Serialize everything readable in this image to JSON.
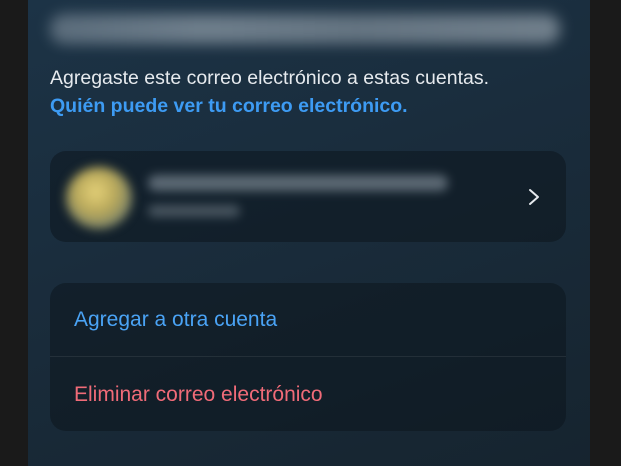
{
  "description": {
    "text": "Agregaste este correo electrónico a estas cuentas.",
    "link": "Quién puede ver tu correo electrónico."
  },
  "account": {
    "icon": "chevron-right-icon"
  },
  "actions": {
    "add_label": "Agregar a otra cuenta",
    "remove_label": "Eliminar correo electrónico"
  },
  "colors": {
    "link": "#3d9bf3",
    "action_add": "#4aa3f5",
    "action_remove": "#f06b78",
    "text": "#e6eaee"
  }
}
